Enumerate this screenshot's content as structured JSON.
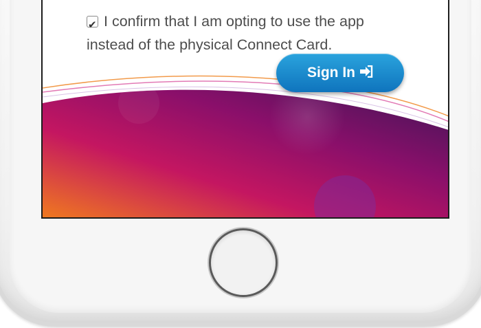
{
  "screen": {
    "confirm_text": "I confirm that I am opting to use the app instead of the physical Connect Card.",
    "confirm_checked": true,
    "signin_label": "Sign In",
    "signin_icon": "sign-in-icon"
  },
  "colors": {
    "button_top": "#2aa3dd",
    "button_bottom": "#0f74bd",
    "gradient_orange": "#f07a1f",
    "gradient_magenta": "#a8125f",
    "gradient_purple": "#3e1657"
  }
}
